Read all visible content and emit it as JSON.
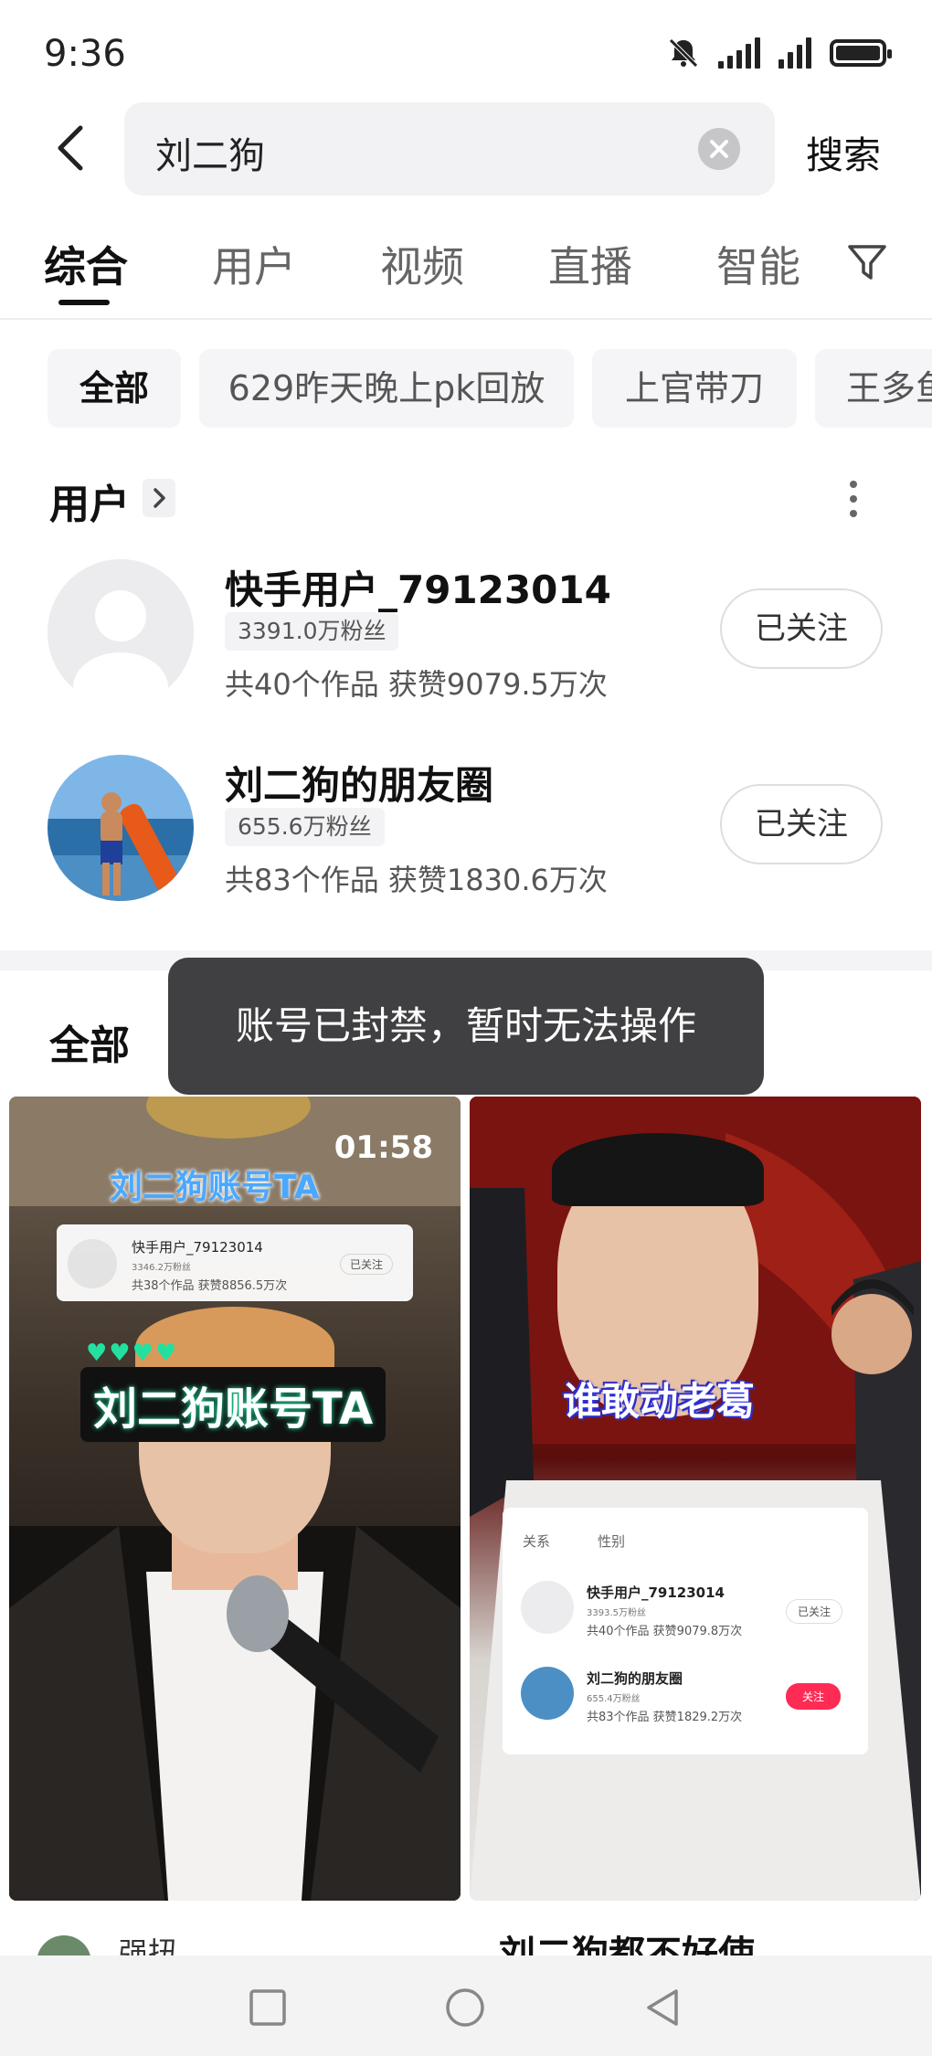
{
  "status_bar": {
    "time": "9:36",
    "icons": [
      "mute-bell-icon",
      "signal-icon",
      "signal-icon",
      "battery-charging-icon"
    ]
  },
  "search": {
    "query": "刘二狗",
    "search_button": "搜索"
  },
  "tabs": [
    {
      "label": "综合",
      "active": true
    },
    {
      "label": "用户",
      "active": false
    },
    {
      "label": "视频",
      "active": false
    },
    {
      "label": "直播",
      "active": false
    },
    {
      "label": "智能",
      "active": false
    }
  ],
  "chips": [
    {
      "label": "全部",
      "active": true
    },
    {
      "label": "629昨天晚上pk回放",
      "active": false
    },
    {
      "label": "上官带刀",
      "active": false
    },
    {
      "label": "王多鱼",
      "active": false
    }
  ],
  "users_section": {
    "title": "用户",
    "users": [
      {
        "name": "快手用户_79123014",
        "fans": "3391.0万粉丝",
        "stats": "共40个作品 获赞9079.5万次",
        "follow_label": "已关注"
      },
      {
        "name": "刘二狗的朋友圈",
        "fans": "655.6万粉丝",
        "stats": "共83个作品 获赞1830.6万次",
        "follow_label": "已关注"
      }
    ]
  },
  "all_section": {
    "title": "全部"
  },
  "toast": "账号已封禁，暂时无法操作",
  "videos": [
    {
      "duration": "01:58",
      "overlay_top": "刘二狗账号TA",
      "overlay_big": "刘二狗账号TA",
      "mini_user": {
        "name": "快手用户_79123014",
        "fans": "3346.2万粉丝",
        "stats": "共38个作品 获赞8856.5万次",
        "follow": "已关注"
      }
    },
    {
      "overlay_big": "谁敢动老葛",
      "filters": [
        "关系",
        "性别"
      ],
      "mini_users": [
        {
          "name": "快手用户_79123014",
          "fans": "3393.5万粉丝",
          "stats": "共40个作品 获赞9079.8万次",
          "follow": "已关注"
        },
        {
          "name": "刘二狗的朋友圈",
          "fans": "655.4万粉丝",
          "stats": "共83个作品 获赞1829.2万次",
          "follow": "关注"
        }
      ]
    }
  ],
  "below_cards": {
    "left_text": "强扭",
    "right_title": "刘二狗都不好使"
  },
  "colors": {
    "accent_red": "#fe2c55",
    "toast_bg": "#323234"
  }
}
